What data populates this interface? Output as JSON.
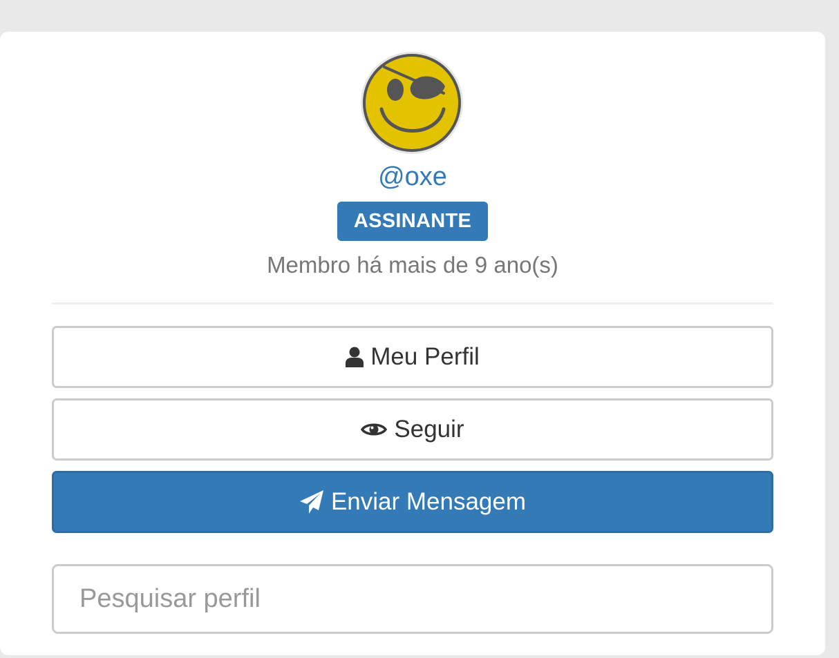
{
  "profile": {
    "username": "@oxe",
    "badge": "ASSINANTE",
    "member_since": "Membro há mais de 9 ano(s)",
    "avatar_icon": "pirate-smiley-avatar"
  },
  "actions": {
    "profile_label": "Meu Perfil",
    "profile_icon": "user-icon",
    "follow_label": "Seguir",
    "follow_icon": "eye-icon",
    "message_label": "Enviar Mensagem",
    "message_icon": "paper-plane-icon"
  },
  "search": {
    "placeholder": "Pesquisar perfil",
    "value": ""
  },
  "colors": {
    "primary": "#337ab7",
    "avatar_yellow": "#e3c300",
    "text_muted": "#777777"
  }
}
